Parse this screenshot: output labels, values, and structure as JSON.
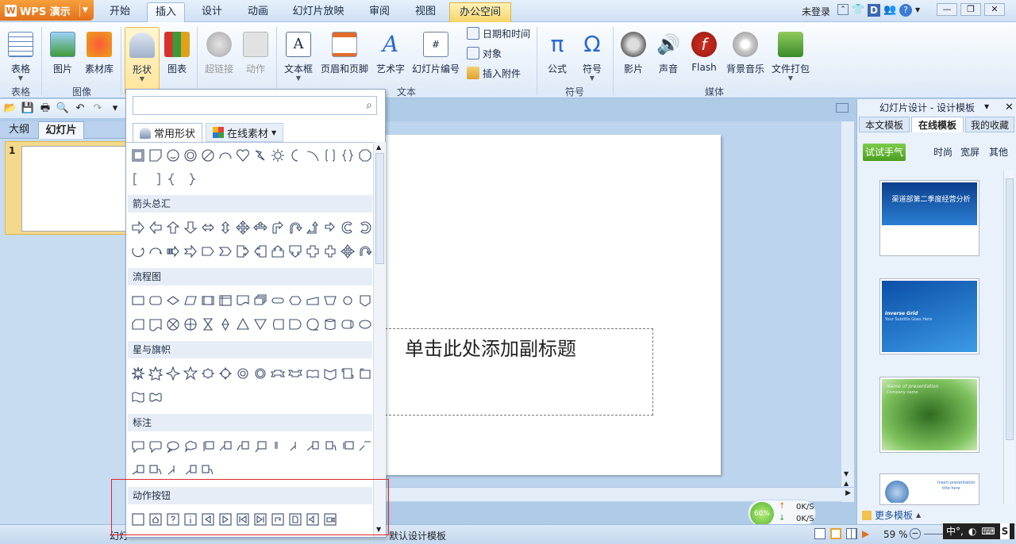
{
  "app": {
    "title": "WPS 演示"
  },
  "menu_tabs": [
    "开始",
    "插入",
    "设计",
    "动画",
    "幻灯片放映",
    "审阅",
    "视图",
    "办公空间"
  ],
  "menu_active": "插入",
  "account": {
    "status": "未登录"
  },
  "ribbon": {
    "buttons": [
      "表格",
      "图片",
      "素材库",
      "形状",
      "图表",
      "超链接",
      "动作",
      "文本框",
      "页眉和页脚",
      "艺术字",
      "幻灯片编号",
      "公式",
      "符号",
      "影片",
      "声音",
      "Flash",
      "背景音乐",
      "文件打包"
    ],
    "small_buttons": [
      "日期和时间",
      "对象",
      "插入附件"
    ],
    "groups": [
      "表格",
      "图像",
      "文本",
      "符号",
      "媒体"
    ]
  },
  "left_pane": {
    "tabs": [
      "大纲",
      "幻灯片"
    ],
    "slide_number": "1"
  },
  "slide": {
    "subtitle_placeholder": "单击此处添加副标题"
  },
  "shapes_dropdown": {
    "search_placeholder": "",
    "tabs": [
      "常用形状",
      "在线素材"
    ],
    "sections": [
      "箭头总汇",
      "流程图",
      "星与旗帜",
      "标注",
      "动作按钮"
    ]
  },
  "right_pane": {
    "title": "幻灯片设计 - 设计模板",
    "tabs": [
      "本文模板",
      "在线模板",
      "我的收藏"
    ],
    "try_button": "试试手气",
    "filters": [
      "时尚",
      "宽屏",
      "其他"
    ],
    "templates": [
      {
        "title": "渠道部第二季度经营分析",
        "color": "#1d5fae"
      },
      {
        "title": "Inverse Grid",
        "subtitle": "Your Subtitle Goes Here",
        "color": "#1e73c8"
      },
      {
        "title": "Name of presentation",
        "subtitle": "Company name",
        "color": "#5aa73c"
      },
      {
        "title": "Insert presentation",
        "subtitle": "title here",
        "color": "#ffffff"
      }
    ],
    "more_templates": "更多模板"
  },
  "network": {
    "percent": "60%",
    "up": "0K/S",
    "down": "0K/S"
  },
  "status_bar": {
    "slide_info": "幻灯",
    "template_name": "默认设计模板",
    "zoom": "59 %"
  },
  "ime": {
    "text": "中°,"
  },
  "colors": {
    "accent": "#e2701b",
    "highlight": "#e0262b",
    "office_tab": "#f6d46a"
  }
}
